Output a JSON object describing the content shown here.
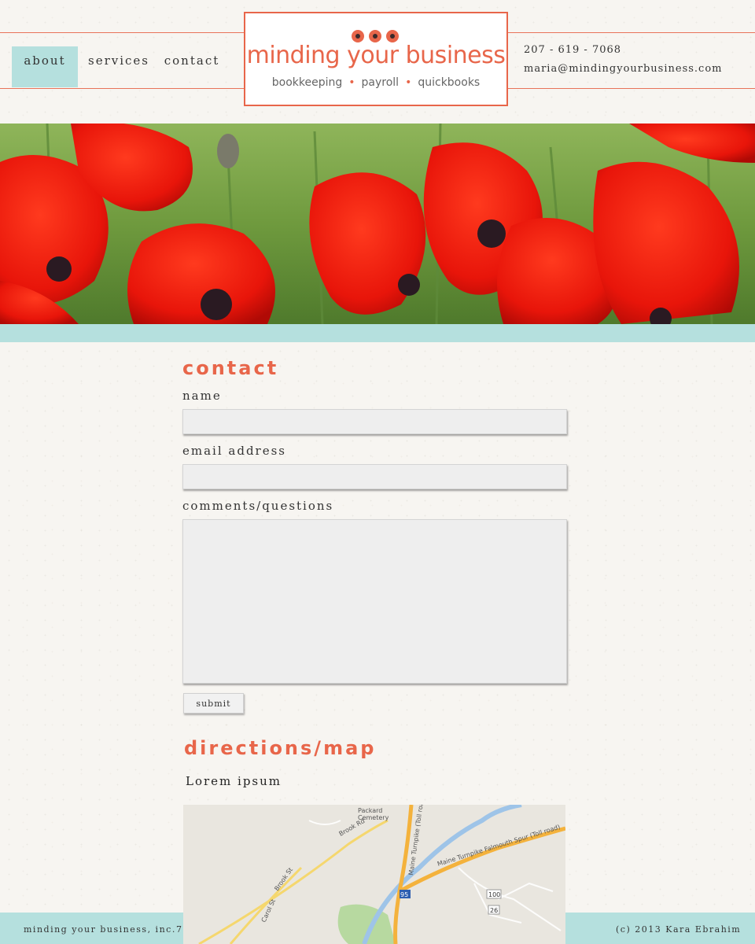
{
  "nav": {
    "items": [
      {
        "label": "about"
      },
      {
        "label": "services"
      },
      {
        "label": "contact"
      }
    ]
  },
  "logo": {
    "title": "minding your business",
    "services": [
      "bookkeeping",
      "payroll",
      "quickbooks"
    ]
  },
  "header_contact": {
    "phone": "207 - 619 - 7068",
    "email": "maria@mindingyourbusiness.com"
  },
  "contact_form": {
    "heading": "contact",
    "name_label": "name",
    "email_label": "email address",
    "comments_label": "comments/questions",
    "submit_label": "submit"
  },
  "directions": {
    "heading": "directions/map",
    "text": "Lorem ipsum",
    "map_labels": {
      "packard": "Packard",
      "cemetery": "Cemetery",
      "brook_rd": "Brook Rd",
      "brook_st": "Brook St",
      "carol_st": "Carol St",
      "turnpike": "Maine Turnpike (Toll road)",
      "spur": "Maine Turnpike Falmouth Spur (Toll road)",
      "i95": "95",
      "r100": "100",
      "r26": "26"
    }
  },
  "footer": {
    "left": "minding your business, inc.",
    "left_cut": "7",
    "right": "(c) 2013 Kara Ebrahim"
  },
  "colors": {
    "accent": "#e8664a",
    "teal": "#b5e0de"
  }
}
